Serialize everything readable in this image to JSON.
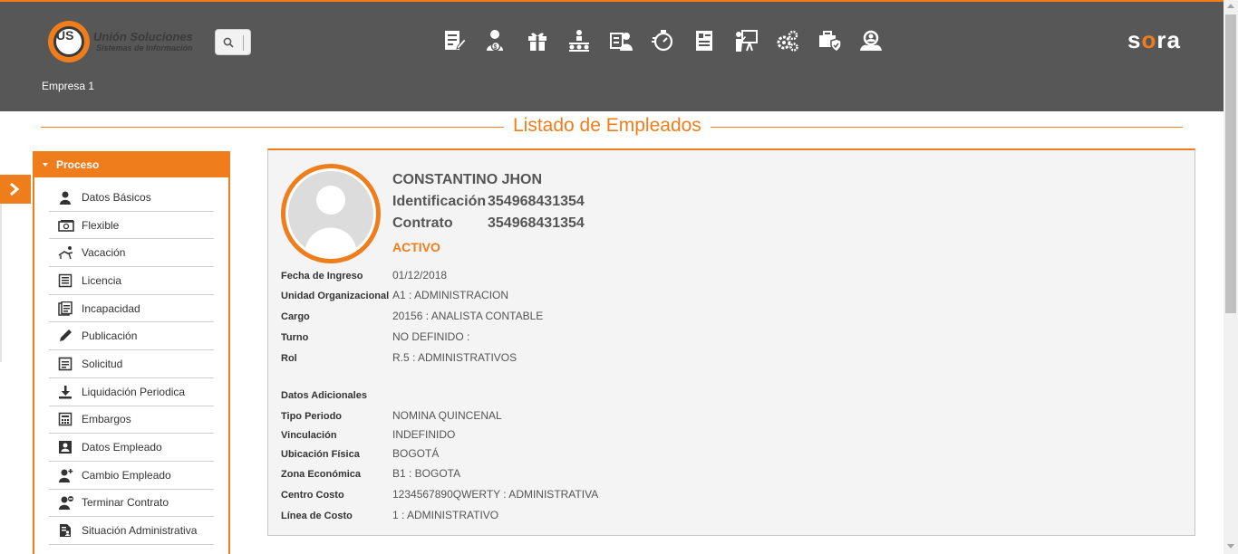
{
  "header": {
    "logo_mark": "US",
    "logo_title": "Unión Soluciones",
    "logo_subtitle": "Sistemas de Información",
    "brand_left": "s",
    "brand_o": "o",
    "brand_right": "ra",
    "company": "Empresa 1",
    "module_icons": [
      "edit-document-icon",
      "person-money-icon",
      "gift-icon",
      "org-chart-icon",
      "id-card-person-icon",
      "stopwatch-icon",
      "document-list-icon",
      "presentation-icon",
      "gears-icon",
      "briefcase-shield-icon",
      "people-search-icon"
    ]
  },
  "page": {
    "title": "Listado de Empleados"
  },
  "sidebar": {
    "section": "Proceso",
    "items": [
      {
        "label": "Datos Básicos",
        "icon": "person-icon"
      },
      {
        "label": "Flexible",
        "icon": "cash-icon"
      },
      {
        "label": "Vacación",
        "icon": "beach-chair-icon"
      },
      {
        "label": "Licencia",
        "icon": "form-icon"
      },
      {
        "label": "Incapacidad",
        "icon": "medical-record-icon"
      },
      {
        "label": "Publicación",
        "icon": "pen-icon"
      },
      {
        "label": "Solicitud",
        "icon": "note-icon"
      },
      {
        "label": "Liquidación Periodica",
        "icon": "download-icon"
      },
      {
        "label": "Embargos",
        "icon": "calculator-icon"
      },
      {
        "label": "Datos Empleado",
        "icon": "id-badge-icon"
      },
      {
        "label": "Cambio Empleado",
        "icon": "person-change-icon"
      },
      {
        "label": "Terminar Contrato",
        "icon": "person-remove-icon"
      },
      {
        "label": "Situación Administrativa",
        "icon": "file-person-icon"
      }
    ]
  },
  "employee": {
    "name": "CONSTANTINO JHON",
    "id_label": "Identificación",
    "id_value": "354968431354",
    "contract_label": "Contrato",
    "contract_value": "354968431354",
    "status": "ACTIVO",
    "fields": [
      {
        "label": "Fecha de Ingreso",
        "value": "01/12/2018"
      },
      {
        "label": "Unidad Organizacional",
        "value": "A1 : ADMINISTRACION"
      },
      {
        "label": "Cargo",
        "value": "20156 : ANALISTA CONTABLE"
      },
      {
        "label": "Turno",
        "value": "NO DEFINIDO :"
      },
      {
        "label": "Rol",
        "value": "R.5 : ADMINISTRATIVOS"
      }
    ],
    "extra_title": "Datos Adicionales",
    "extra": [
      {
        "label": "Tipo Periodo",
        "value": "NOMINA QUINCENAL"
      },
      {
        "label": "Vinculación",
        "value": "INDEFINIDO"
      },
      {
        "label": "Ubicación Física",
        "value": "BOGOTÁ"
      },
      {
        "label": "Zona Económica",
        "value": "B1 : BOGOTA"
      },
      {
        "label": "Centro Costo",
        "value": "1234567890QWERTY : ADMINISTRATIVA"
      },
      {
        "label": "Línea de Costo",
        "value": "1 : ADMINISTRATIVO"
      }
    ]
  },
  "colors": {
    "accent": "#f07d1c",
    "header_bg": "#575757"
  }
}
